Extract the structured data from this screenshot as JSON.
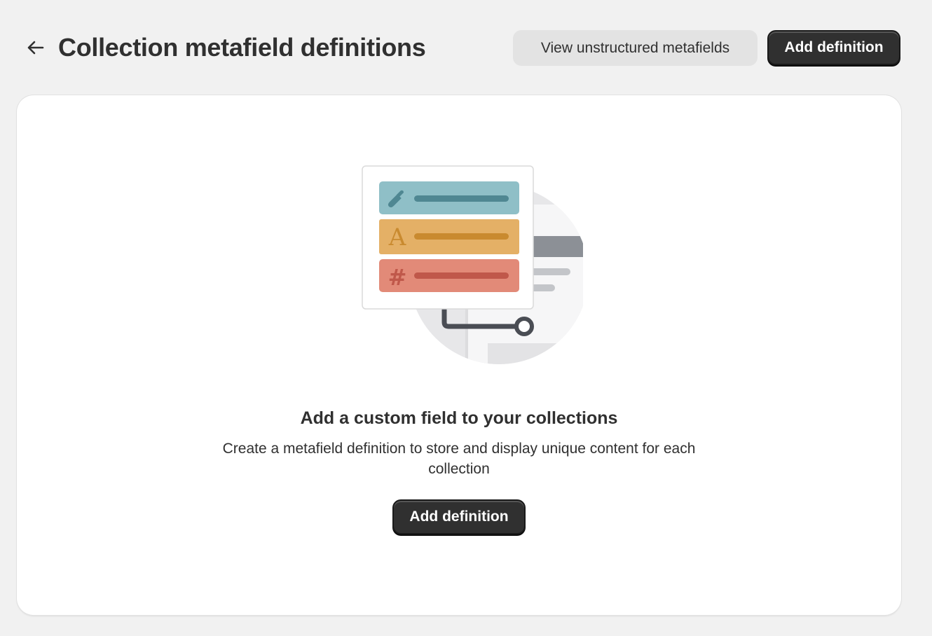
{
  "header": {
    "back_icon": "arrow-left-icon",
    "title": "Collection metafield definitions",
    "view_unstructured_label": "View unstructured metafields",
    "add_definition_label": "Add definition"
  },
  "empty_state": {
    "illustration_icons": [
      "eyedropper-icon",
      "letter-a-icon",
      "hash-icon"
    ],
    "heading": "Add a custom field to your collections",
    "description": "Create a metafield definition to store and display unique content for each collection",
    "add_definition_label": "Add definition"
  },
  "colors": {
    "page_background": "#f1f1f1",
    "primary_button": "#303030",
    "secondary_button": "#e3e3e3",
    "row_teal": "#8fbfc7",
    "row_yellow": "#e4b066",
    "row_red": "#e28a78"
  }
}
